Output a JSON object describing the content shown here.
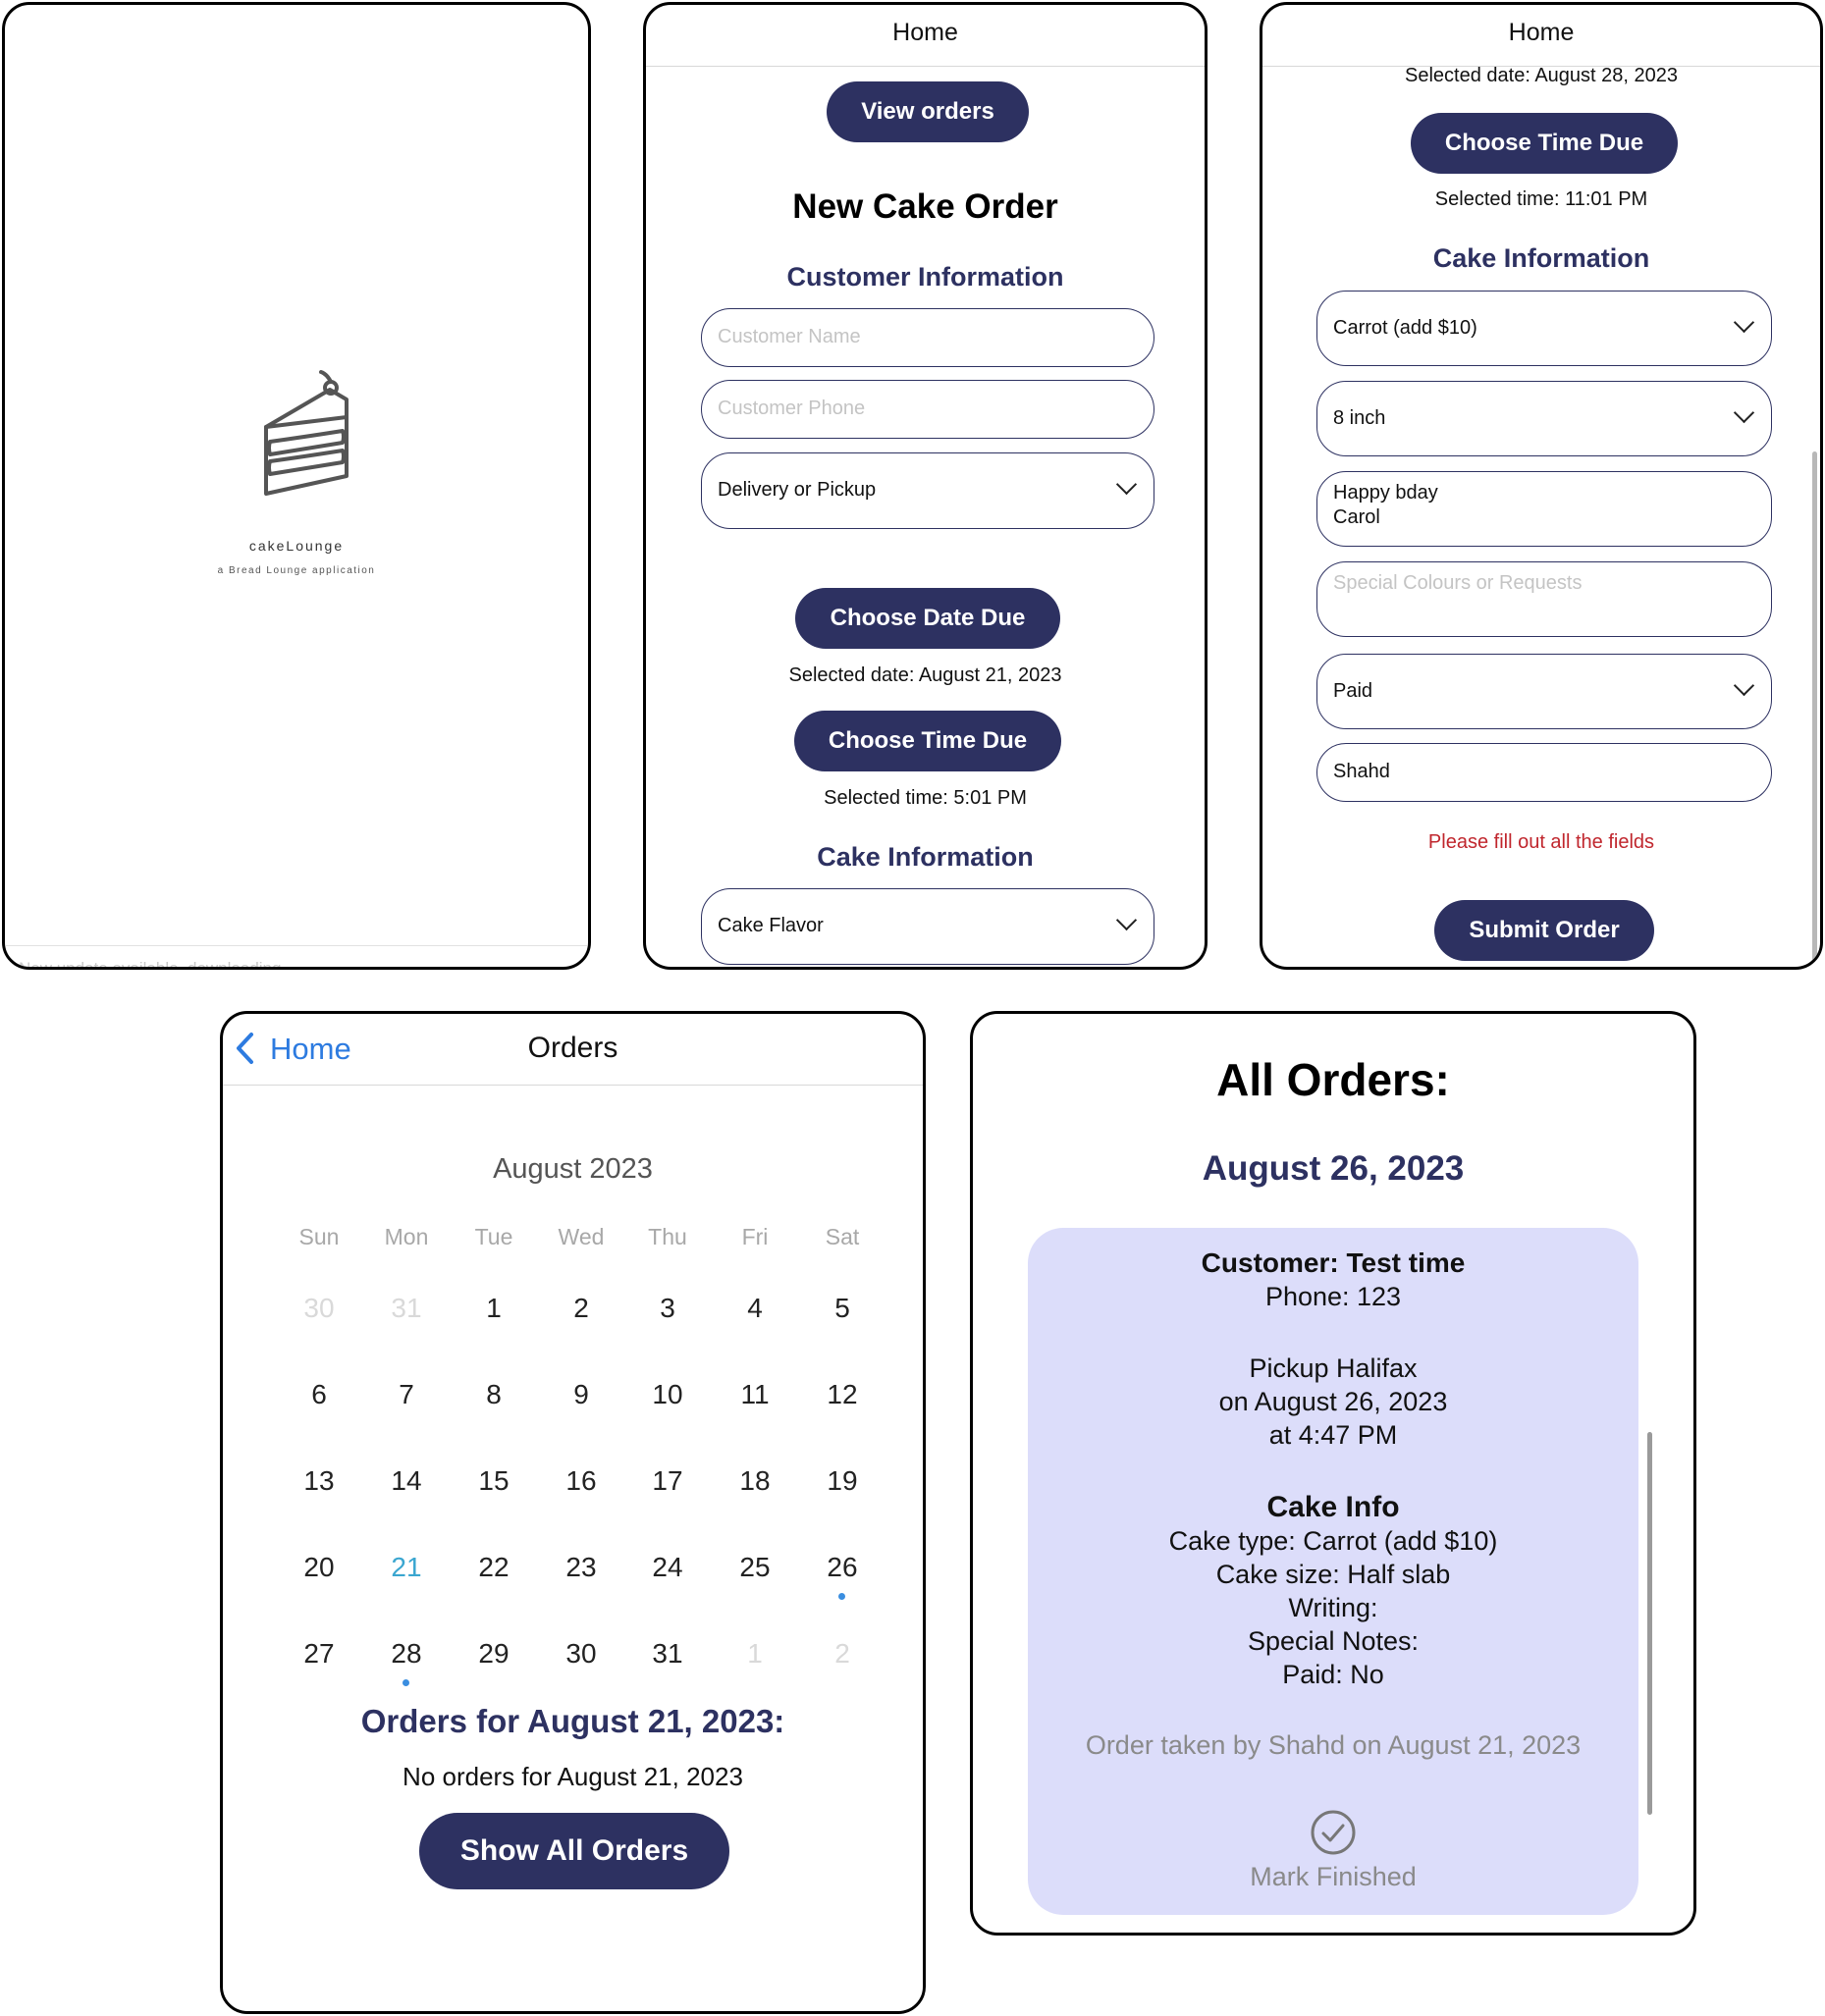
{
  "splash": {
    "brand": "cakeLounge",
    "tagline": "a Bread Lounge application",
    "status": "New update available, downloading..."
  },
  "order_form_top": {
    "nav_title": "Home",
    "view_orders_label": "View orders",
    "heading": "New Cake Order",
    "customer_section": "Customer Information",
    "customer_name_placeholder": "Customer Name",
    "customer_phone_placeholder": "Customer Phone",
    "delivery_select": "Delivery or Pickup",
    "choose_date_label": "Choose Date Due",
    "selected_date": "Selected date: August 21, 2023",
    "choose_time_label": "Choose Time Due",
    "selected_time": "Selected time: 5:01 PM",
    "cake_section": "Cake Information",
    "cake_flavor_select": "Cake Flavor"
  },
  "order_form_bottom": {
    "nav_title": "Home",
    "selected_date": "Selected date: August 28, 2023",
    "choose_time_label": "Choose Time Due",
    "selected_time": "Selected time: 11:01 PM",
    "cake_section": "Cake Information",
    "flavor_value": "Carrot (add $10)",
    "size_value": "8 inch",
    "writing_line1": "Happy bday",
    "writing_line2": "Carol",
    "special_placeholder": "Special Colours or Requests",
    "paid_value": "Paid",
    "taken_by_value": "Shahd",
    "error_text": "Please fill out all the fields",
    "submit_label": "Submit Order"
  },
  "orders_calendar": {
    "back_label": "Home",
    "nav_title": "Orders",
    "month_label": "August 2023",
    "weekdays": [
      "Sun",
      "Mon",
      "Tue",
      "Wed",
      "Thu",
      "Fri",
      "Sat"
    ],
    "weeks": [
      [
        "30",
        "31",
        "1",
        "2",
        "3",
        "4",
        "5"
      ],
      [
        "6",
        "7",
        "8",
        "9",
        "10",
        "11",
        "12"
      ],
      [
        "13",
        "14",
        "15",
        "16",
        "17",
        "18",
        "19"
      ],
      [
        "20",
        "21",
        "22",
        "23",
        "24",
        "25",
        "26"
      ],
      [
        "27",
        "28",
        "29",
        "30",
        "31",
        "1",
        "2"
      ]
    ],
    "orders_heading": "Orders for August 21, 2023:",
    "no_orders_text": "No orders for August 21, 2023",
    "show_all_label": "Show All Orders"
  },
  "all_orders": {
    "heading": "All Orders:",
    "date_heading": "August 26, 2023",
    "card": {
      "customer": "Customer: Test time",
      "phone": "Phone: 123",
      "pickup_line": "Pickup Halifax",
      "date_line": "on August 26, 2023",
      "time_line": "at 4:47 PM",
      "cake_info_title": "Cake Info",
      "cake_type": "Cake type: Carrot (add $10)",
      "cake_size": "Cake size: Half slab",
      "writing": "Writing:",
      "special_notes": "Special Notes:",
      "paid": "Paid: No",
      "taken_by": "Order taken by Shahd on August 21, 2023",
      "mark_finished_label": "Mark Finished"
    }
  },
  "colors": {
    "accent": "#2d3161",
    "card_bg": "#dcddfa",
    "error": "#c0262d",
    "today": "#3aa6d0",
    "link": "#2d7be0"
  }
}
